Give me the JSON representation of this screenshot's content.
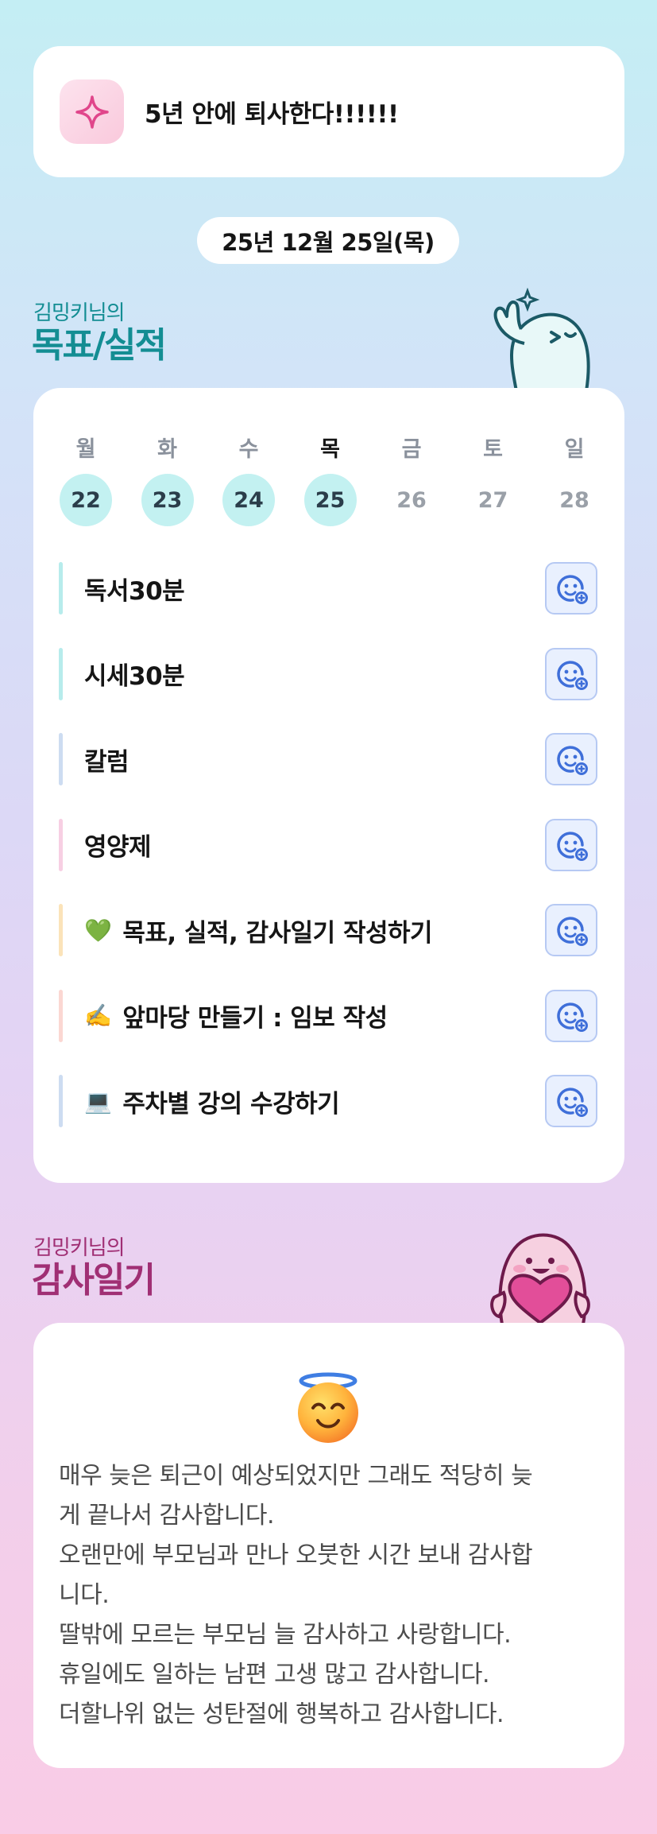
{
  "goal": {
    "icon": "sparkle-icon",
    "text": "5년 안에 퇴사한다!!!!!!"
  },
  "date": "25년 12월 25일(목)",
  "performance": {
    "owner": "김밍키님의",
    "title": "목표/실적",
    "week": [
      {
        "day": "월",
        "date": "22",
        "done": true
      },
      {
        "day": "화",
        "date": "23",
        "done": true
      },
      {
        "day": "수",
        "date": "24",
        "done": true
      },
      {
        "day": "목",
        "date": "25",
        "done": true,
        "today": true
      },
      {
        "day": "금",
        "date": "26",
        "done": false
      },
      {
        "day": "토",
        "date": "27",
        "done": false
      },
      {
        "day": "일",
        "date": "28",
        "done": false
      }
    ],
    "tasks": [
      {
        "label": "독서30분",
        "emoji": "",
        "color": "#b7ecec"
      },
      {
        "label": "시세30분",
        "emoji": "",
        "color": "#b7ecec"
      },
      {
        "label": "칼럼",
        "emoji": "",
        "color": "#cddcf1"
      },
      {
        "label": "영양제",
        "emoji": "",
        "color": "#f7cfe3"
      },
      {
        "label": "목표, 실적, 감사일기 작성하기",
        "emoji": "💚",
        "color": "#fbe3b9"
      },
      {
        "label": "앞마당 만들기 : 임보 작성",
        "emoji": "✍️",
        "color": "#fbd7d2"
      },
      {
        "label": "주차별 강의 수강하기",
        "emoji": "💻",
        "color": "#cddcf1"
      }
    ]
  },
  "thanks": {
    "owner": "김밍키님의",
    "title": "감사일기",
    "face_icon": "smiling-face-with-halo-icon",
    "lines": [
      "매우 늦은 퇴근이 예상되었지만 그래도 적당히 늦",
      "게 끝나서 감사합니다.",
      "오랜만에 부모님과 만나 오붓한 시간 보내 감사합",
      "니다.",
      "딸밖에 모르는 부모님 늘 감사하고 사랑합니다.",
      "휴일에도 일하는 남편 고생 많고 감사합니다.",
      "더할나위 없는 성탄절에 행복하고 감사합니다."
    ]
  },
  "colors": {
    "accent_teal": "#138d93",
    "accent_plum": "#a02f74",
    "done_circle": "#c3f1f1",
    "task_button_bg": "#e9f0fe"
  }
}
